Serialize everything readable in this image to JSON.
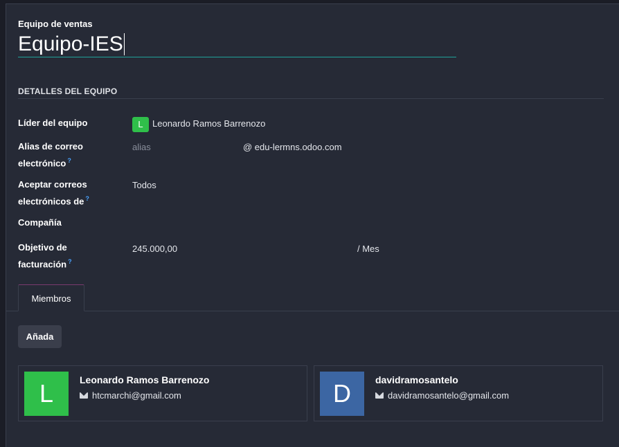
{
  "form": {
    "name_label": "Equipo de ventas",
    "name_value": "Equipo-IES"
  },
  "section": {
    "title": "DETALLES DEL EQUIPO"
  },
  "fields": {
    "leader_label": "Líder del equipo",
    "leader_initial": "L",
    "leader_value": "Leonardo Ramos Barrenozo",
    "alias_label_line1": "Alias de correo",
    "alias_label_line2": "electrónico",
    "alias_placeholder": "alias",
    "alias_domain": "@ edu-lermns.odoo.com",
    "accept_label_line1": "Aceptar correos",
    "accept_label_line2": "electrónicos de",
    "accept_value": "Todos",
    "company_label": "Compañía",
    "target_label_line1": "Objetivo de",
    "target_label_line2": "facturación",
    "target_value": "245.000,00",
    "target_unit": "/ Mes",
    "help_mark": "?"
  },
  "tabs": {
    "members_label": "Miembros"
  },
  "members": {
    "add_label": "Añada",
    "cards": [
      {
        "initial": "L",
        "name": "Leonardo Ramos Barrenozo",
        "email": "htcmarchi@gmail.com",
        "color": "#2fbf4a"
      },
      {
        "initial": "D",
        "name": "davidramosantelo",
        "email": "davidramosantelo@gmail.com",
        "color": "#3c66a3"
      }
    ]
  },
  "colors": {
    "accent_underline": "#1fa39a",
    "help_icon": "#4aa3ff",
    "background": "#262a36"
  }
}
